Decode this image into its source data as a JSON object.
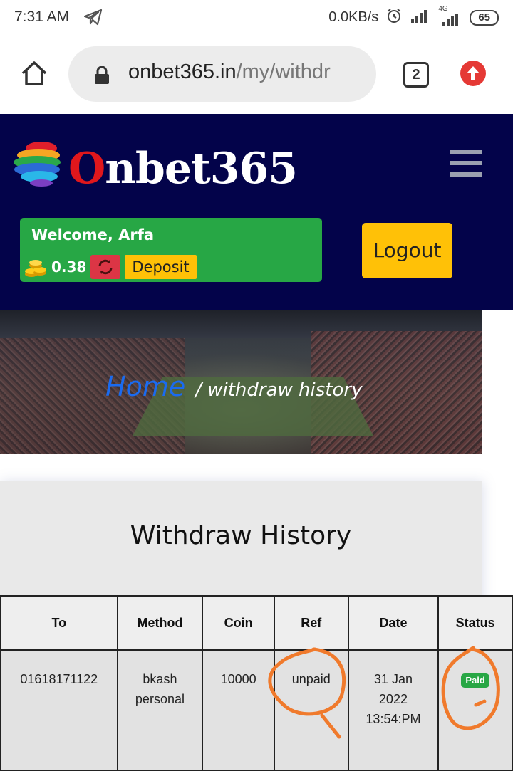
{
  "status_bar": {
    "time": "7:31 AM",
    "speed": "0.0KB/s",
    "network": "4G",
    "battery": "65",
    "icons": [
      "telegram-icon",
      "alarm-icon",
      "signal-icon",
      "signal-4g-icon",
      "battery-icon"
    ]
  },
  "browser": {
    "url_domain": "onbet365.in",
    "url_path": "/my/withdr",
    "tab_count": "2",
    "icons": [
      "home-icon",
      "lock-icon",
      "upload-icon"
    ]
  },
  "header": {
    "logo_first": "O",
    "logo_rest": "nbet365",
    "welcome": "Welcome, Arfa",
    "balance": "0.38",
    "deposit_label": "Deposit",
    "logout_label": "Logout",
    "icons": [
      "logo-ball-icon",
      "menu-icon",
      "coins-icon",
      "refresh-icon"
    ]
  },
  "banner": {
    "home_label": "Home",
    "current": "/ withdraw history"
  },
  "history": {
    "title": "Withdraw History",
    "columns": [
      "To",
      "Method",
      "Coin",
      "Ref",
      "Date",
      "Status"
    ],
    "rows": [
      {
        "to": "01618171122",
        "method_line1": "bkash",
        "method_line2": "personal",
        "coin": "10000",
        "ref": "unpaid",
        "date_line1": "31 Jan",
        "date_line2": "2022",
        "date_line3": "13:54:PM",
        "status": "Paid"
      }
    ]
  },
  "colors": {
    "header_bg": "#03034a",
    "welcome_bg": "#27a745",
    "refresh_bg": "#dc3545",
    "accent_yellow": "#ffc107",
    "link_blue": "#1a6bf0",
    "annotation_orange": "#f07a2c"
  }
}
